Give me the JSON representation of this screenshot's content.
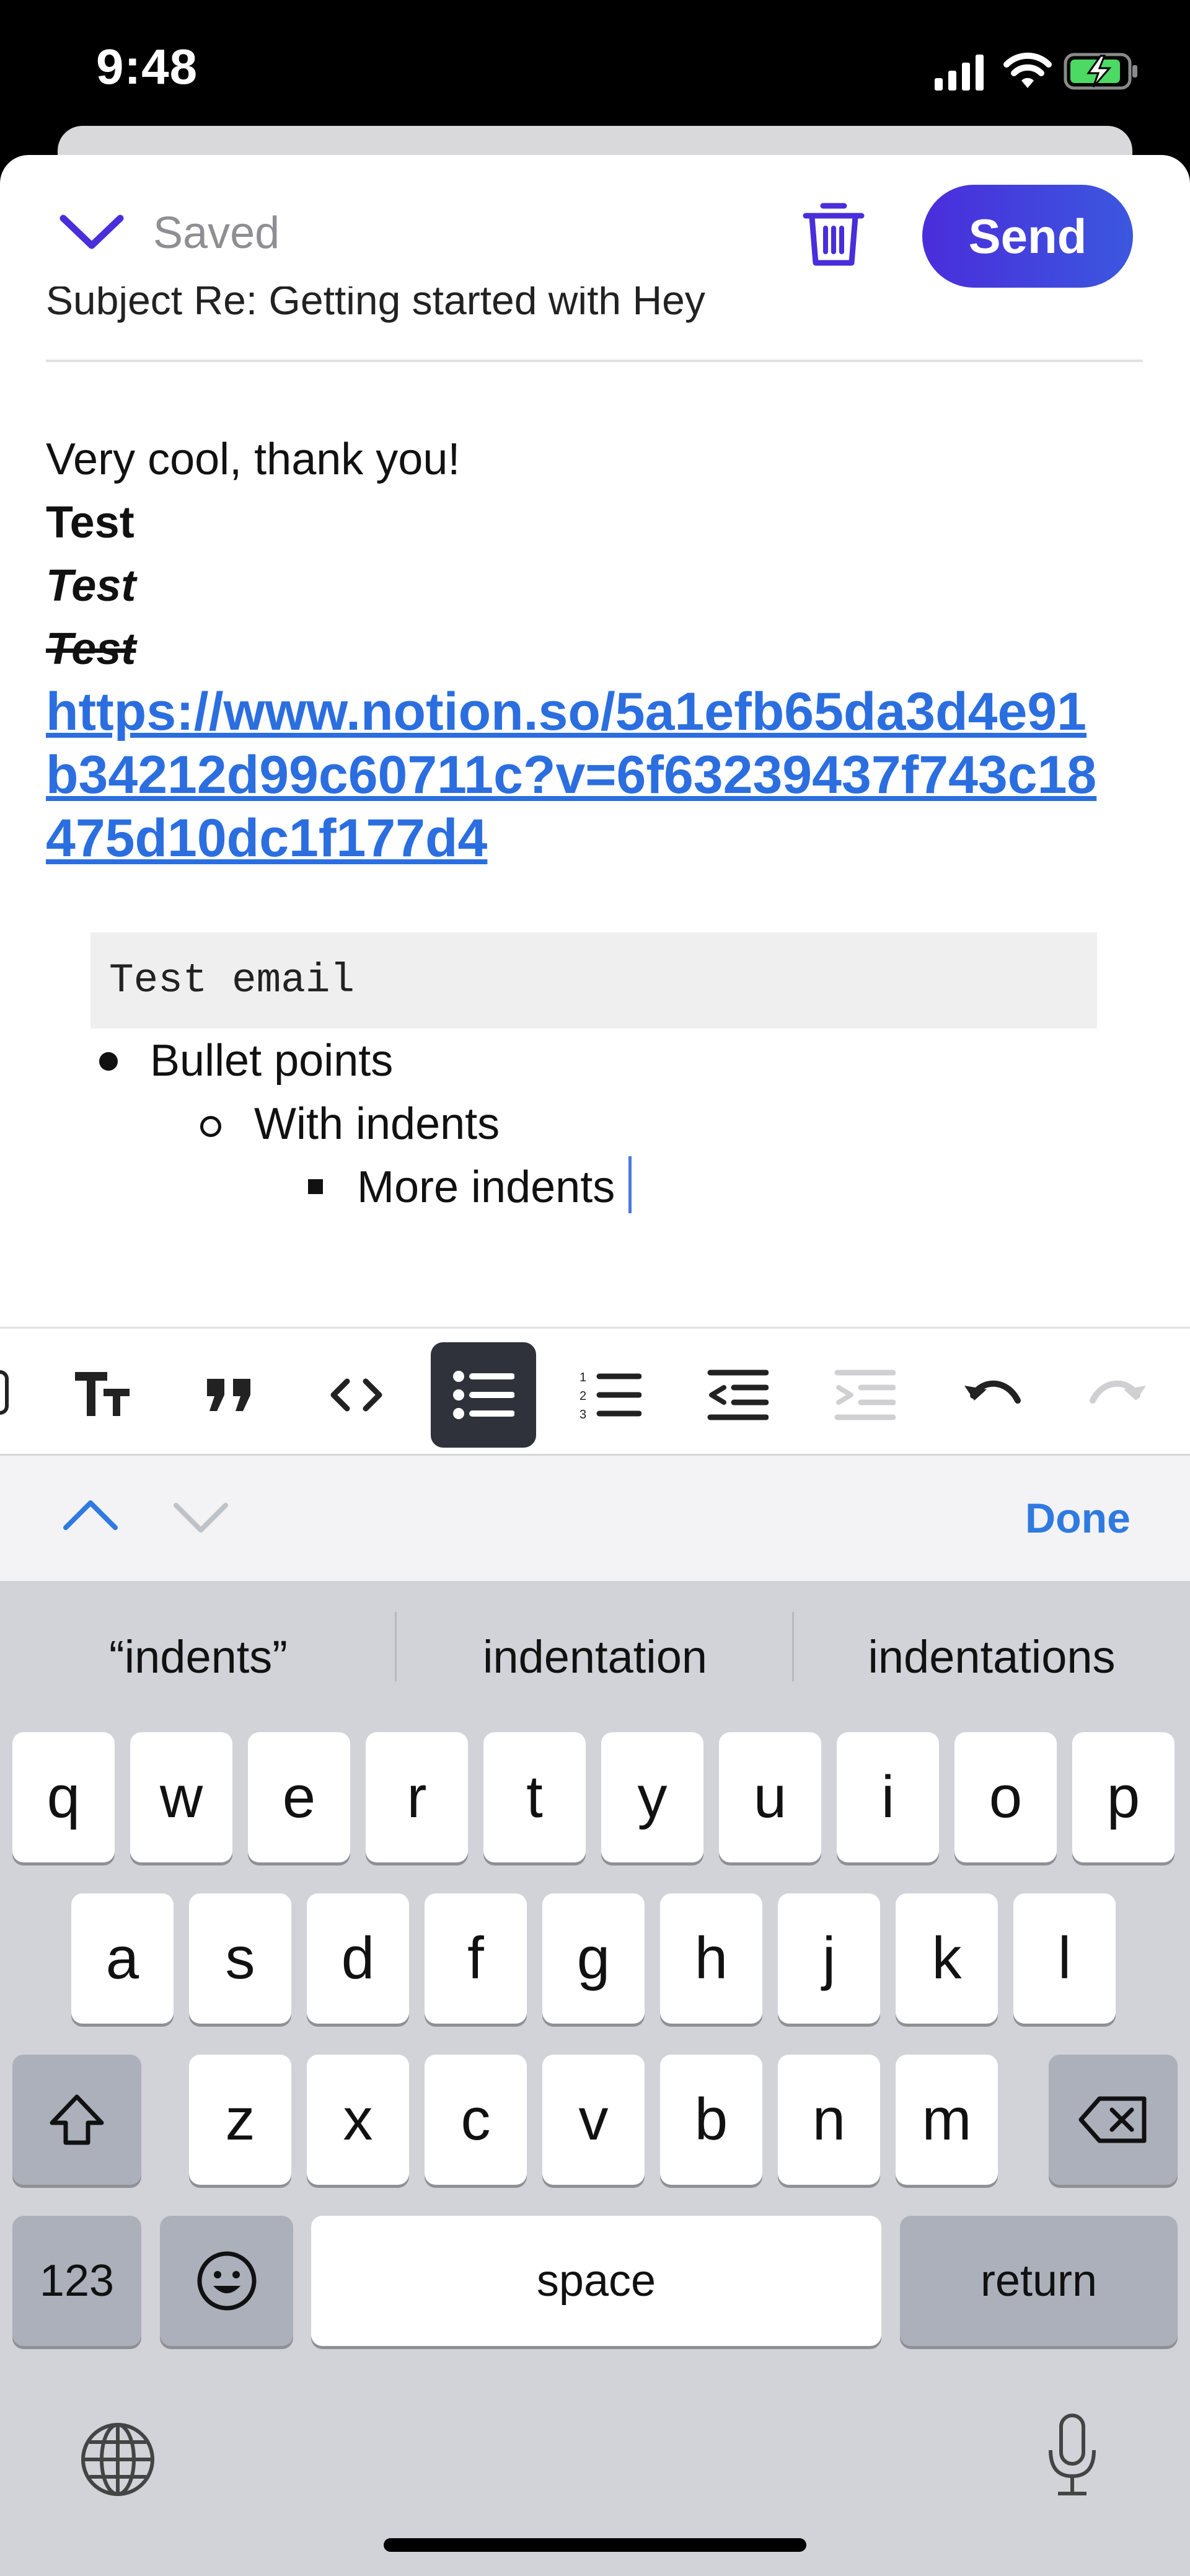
{
  "status_bar": {
    "time": "9:48"
  },
  "header": {
    "saved_label": "Saved",
    "send_label": "Send"
  },
  "subject": {
    "text": "Subject    Re: Getting started with Hey"
  },
  "body": {
    "line1": "Very cool, thank you!",
    "bold_text": "Test",
    "italic_text": "Test",
    "strike_text": "Test",
    "link": "https://www.notion.so/5a1efb65da3d4e91b34212d99c60711c?v=6f63239437f743c18475d10dc1f177d4",
    "code": "Test email",
    "bullets": [
      "Bullet points",
      "With indents",
      "More indents"
    ]
  },
  "accessory": {
    "done_label": "Done"
  },
  "suggestions": [
    "“indents”",
    "indentation",
    "indentations"
  ],
  "keyboard": {
    "row1": [
      "q",
      "w",
      "e",
      "r",
      "t",
      "y",
      "u",
      "i",
      "o",
      "p"
    ],
    "row2": [
      "a",
      "s",
      "d",
      "f",
      "g",
      "h",
      "j",
      "k",
      "l"
    ],
    "row3": [
      "z",
      "x",
      "c",
      "v",
      "b",
      "n",
      "m"
    ],
    "numbers_key": "123",
    "space_key": "space",
    "return_key": "return"
  },
  "colors": {
    "accent": "#4a2ddb",
    "link": "#2b6ee0",
    "done": "#2f7ae0"
  },
  "icons": [
    "chevron-down-icon",
    "trash-icon",
    "text-size-icon",
    "quote-icon",
    "code-icon",
    "bullet-list-icon",
    "numbered-list-icon",
    "outdent-icon",
    "indent-icon",
    "undo-icon",
    "redo-icon",
    "chevron-up-icon",
    "shift-icon",
    "backspace-icon",
    "emoji-icon",
    "globe-icon",
    "microphone-icon"
  ]
}
